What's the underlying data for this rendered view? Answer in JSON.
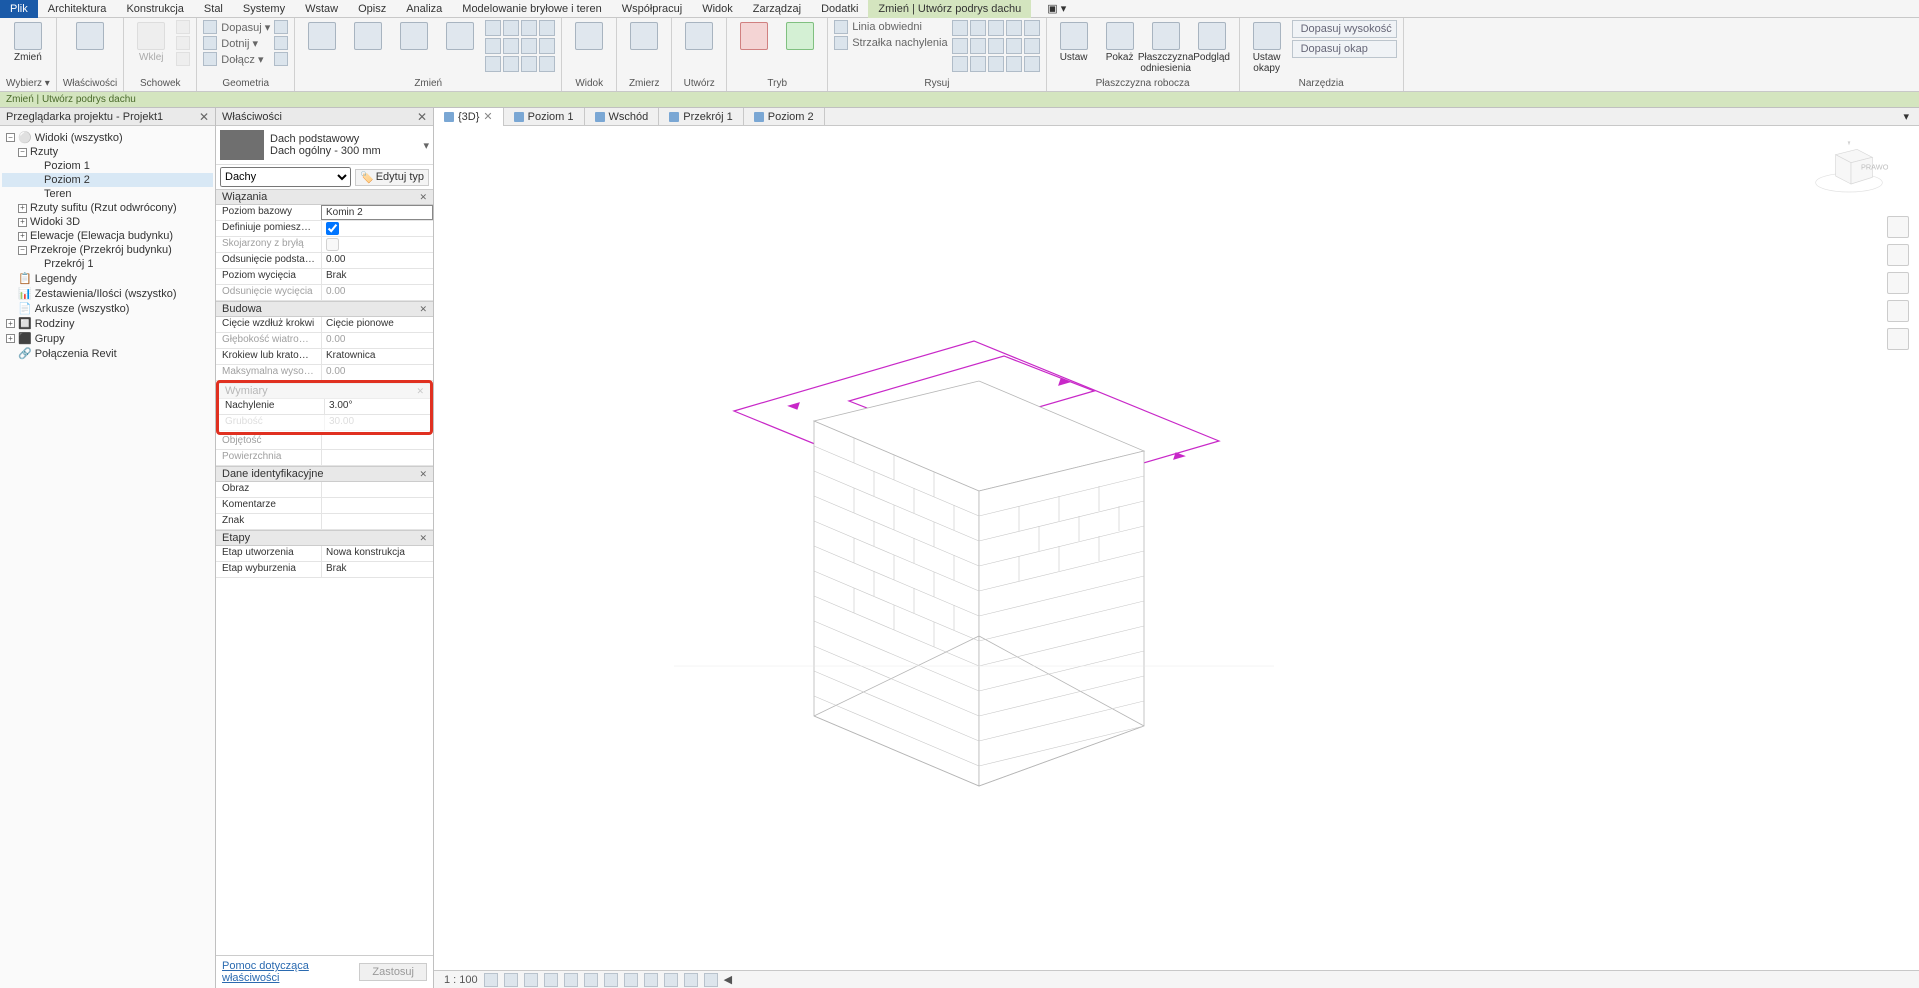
{
  "menu": {
    "file": "Plik",
    "tabs": [
      "Architektura",
      "Konstrukcja",
      "Stal",
      "Systemy",
      "Wstaw",
      "Opisz",
      "Analiza",
      "Modelowanie bryłowe i teren",
      "Współpracuj",
      "Widok",
      "Zarządzaj",
      "Dodatki"
    ],
    "active": "Zmień | Utwórz podrys dachu",
    "help_icon": "▣ ▾"
  },
  "ribbon": {
    "wybierz": {
      "label": "Wybierz ▾",
      "btn": "Zmień"
    },
    "wlasciwosci": {
      "label": "Właściwości"
    },
    "schowek": {
      "label": "Schowek",
      "wklej": "Wklej",
      "dopasuj": "Dopasuj ▾",
      "dotnij": "Dotnij ▾",
      "dolacz": "Dołącz ▾"
    },
    "geometria": {
      "label": "Geometria"
    },
    "zmien": {
      "label": "Zmień"
    },
    "widok": {
      "label": "Widok"
    },
    "zmierz": {
      "label": "Zmierz"
    },
    "utworz": {
      "label": "Utwórz"
    },
    "tryb": {
      "label": "Tryb"
    },
    "rysuj": {
      "label": "Rysuj",
      "linia": "Linia obwiedni",
      "strzalka": "Strzałka nachylenia"
    },
    "plaszczyzna": {
      "label": "Płaszczyzna robocza",
      "ustaw": "Ustaw",
      "pokaz": "Pokaż",
      "ref": "Płaszczyzna odniesienia",
      "podglad": "Podgląd"
    },
    "narzedzia": {
      "label": "Narzędzia",
      "okapy": "Ustaw okapy",
      "d_wys": "Dopasuj wysokość",
      "d_okap": "Dopasuj okap"
    }
  },
  "context_bar": "Zmień | Utwórz podrys dachu",
  "browser": {
    "title": "Przeglądarka projektu - Projekt1",
    "root": "Widoki (wszystko)",
    "rzuty": "Rzuty",
    "poziom1": "Poziom 1",
    "poziom2": "Poziom 2",
    "teren": "Teren",
    "rzuty_sufitu": "Rzuty sufitu (Rzut odwrócony)",
    "widoki3d": "Widoki 3D",
    "elewacje": "Elewacje (Elewacja budynku)",
    "przekroje": "Przekroje (Przekrój budynku)",
    "przekroj1": "Przekrój 1",
    "legendy": "Legendy",
    "zestawienia": "Zestawienia/Ilości (wszystko)",
    "arkusze": "Arkusze (wszystko)",
    "rodziny": "Rodziny",
    "grupy": "Grupy",
    "polaczenia": "Połączenia Revit"
  },
  "props": {
    "title": "Właściwości",
    "type_name": "Dach podstawowy",
    "type_sub": "Dach ogólny - 300 mm",
    "filter": "Dachy",
    "edit_type": "Edytuj typ",
    "g_wiazania": "Wiązania",
    "poziom_bazowy_l": "Poziom bazowy",
    "poziom_bazowy_v": "Komin 2",
    "definiuje_l": "Definiuje pomieszcze...",
    "skojarzony_l": "Skojarzony z bryłą",
    "odsuniecie_l": "Odsunięcie podstaw...",
    "odsuniecie_v": "0.00",
    "poziom_wyc_l": "Poziom wycięcia",
    "poziom_wyc_v": "Brak",
    "odsuniecie_wyc_l": "Odsunięcie wycięcia",
    "odsuniecie_wyc_v": "0.00",
    "g_budowa": "Budowa",
    "ciecie_l": "Cięcie wzdłuż krokwi",
    "ciecie_v": "Cięcie pionowe",
    "glebokosc_l": "Głębokość wiatrowni...",
    "glebokosc_v": "0.00",
    "krokiew_l": "Krokiew lub kratowni...",
    "krokiew_v": "Kratownica",
    "maks_l": "Maksymalna wysoko...",
    "maks_v": "0.00",
    "g_wymiary": "Wymiary",
    "nachylenie_l": "Nachylenie",
    "nachylenie_v": "3.00°",
    "grubosc_l": "Grubość",
    "grubosc_v": "30.00",
    "objetosc_l": "Objętość",
    "powierzchnia_l": "Powierzchnia",
    "g_dane": "Dane identyfikacyjne",
    "obraz_l": "Obraz",
    "komentarze_l": "Komentarze",
    "znak_l": "Znak",
    "g_etapy": "Etapy",
    "etap_utw_l": "Etap utworzenia",
    "etap_utw_v": "Nowa konstrukcja",
    "etap_wyb_l": "Etap wyburzenia",
    "etap_wyb_v": "Brak",
    "help": "Pomoc dotycząca właściwości",
    "apply": "Zastosuj"
  },
  "viewtabs": {
    "t3d": "{3D}",
    "poziom1": "Poziom 1",
    "wschod": "Wschód",
    "przekroj": "Przekrój 1",
    "poziom2": "Poziom 2"
  },
  "scale": "1 : 100",
  "viewcube_face": "PRAWO"
}
